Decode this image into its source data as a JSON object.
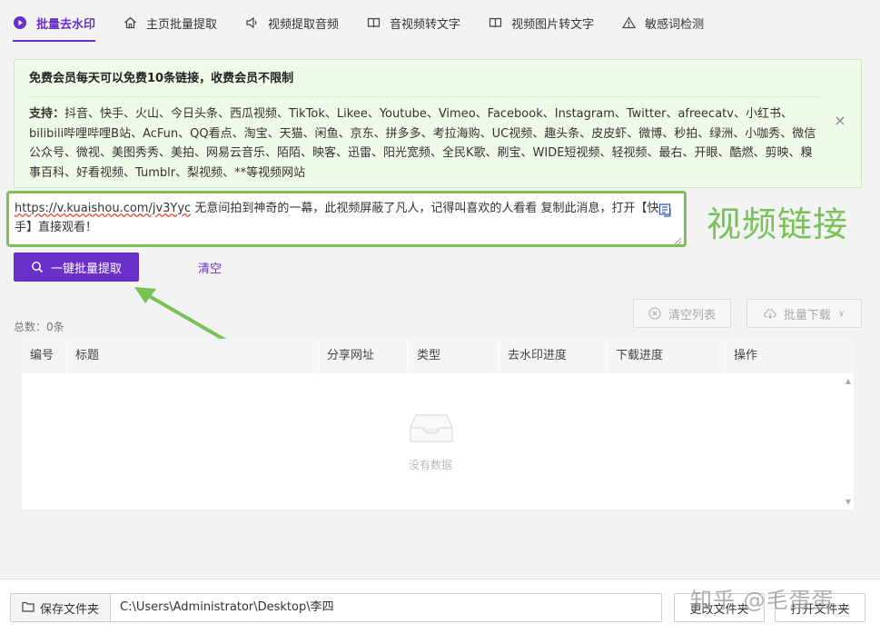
{
  "tabs": [
    {
      "label": "批量去水印",
      "icon": "play-circle-icon",
      "active": true
    },
    {
      "label": "主页批量提取",
      "icon": "home-icon",
      "active": false
    },
    {
      "label": "视频提取音频",
      "icon": "speaker-icon",
      "active": false
    },
    {
      "label": "音视频转文字",
      "icon": "book-icon",
      "active": false
    },
    {
      "label": "视频图片转文字",
      "icon": "book-icon",
      "active": false
    },
    {
      "label": "敏感词检测",
      "icon": "warning-icon",
      "active": false
    }
  ],
  "notice": {
    "title": "免费会员每天可以免费10条链接，收费会员不限制",
    "support_label": "支持：",
    "support_list": "抖音、快手、火山、今日头条、西瓜视频、TikTok、Likee、Youtube、Vimeo、Facebook、Instagram、Twitter、afreecatv、小红书、bilibili哔哩哔哩B站、AcFun、QQ看点、淘宝、天猫、闲鱼、京东、拼多多、考拉海购、UC视频、趣头条、皮皮虾、微博、秒拍、绿洲、小咖秀、微信公众号、微视、美图秀秀、美拍、网易云音乐、陌陌、映客、迅雷、阳光宽频、全民K歌、刷宝、WIDE短视频、轻视频、最右、开眼、酷燃、剪映、糗事百科、好看视频、Tumblr、梨视频、**等视频网站"
  },
  "link_input": {
    "url": "https://v.kuaishou.com/jv3Yyc",
    "text": " 无意间拍到神奇的一幕，此视频屏蔽了凡人，记得叫喜欢的人看看 复制此消息，打开【快手】直接观看！"
  },
  "annotation_label": "视频链接",
  "extract_button": "一键批量提取",
  "clear_link": "清空",
  "total": "总数：0条",
  "clear_list_button": "清空列表",
  "batch_download_button": "批量下载",
  "table": {
    "columns": [
      "编号",
      "标题",
      "分享网址",
      "类型",
      "去水印进度",
      "下载进度",
      "操作"
    ],
    "empty_text": "没有数据"
  },
  "bottom": {
    "save_folder_label": "保存文件夹",
    "folder_path": "C:\\Users\\Administrator\\Desktop\\李四",
    "change_folder_button": "更改文件夹",
    "open_folder_button": "打开文件夹"
  },
  "watermark": "知乎 @毛蛋蛋",
  "colors": {
    "accent": "#6a2fc9",
    "annotation_green": "#78c257",
    "notice_bg": "#f0fae9"
  }
}
